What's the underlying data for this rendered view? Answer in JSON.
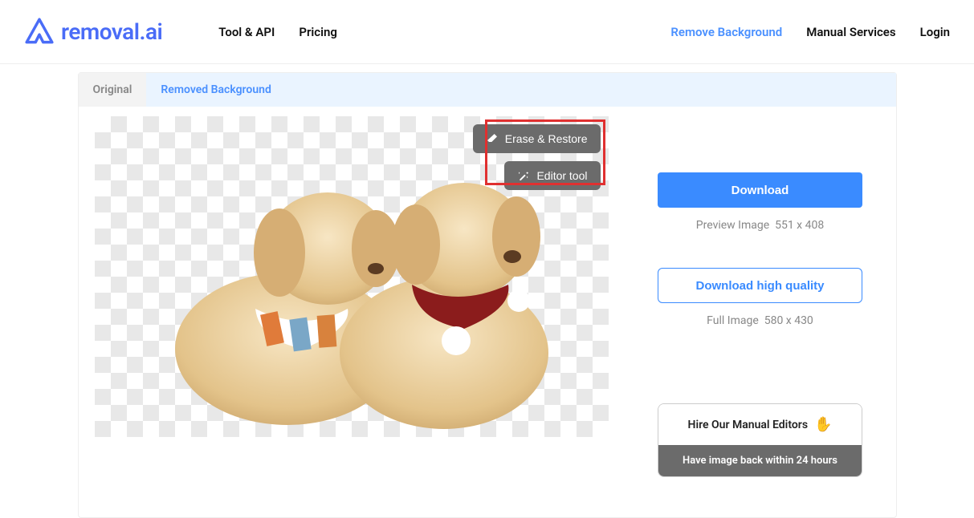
{
  "header": {
    "brand": "removal.ai",
    "nav_left": {
      "tool_api": "Tool & API",
      "pricing": "Pricing"
    },
    "nav_right": {
      "remove_bg": "Remove Background",
      "manual": "Manual Services",
      "login": "Login"
    }
  },
  "tabs": {
    "original": "Original",
    "removed": "Removed Background"
  },
  "overlay": {
    "erase_restore": "Erase & Restore",
    "editor_tool": "Editor tool"
  },
  "sidebar": {
    "download": "Download",
    "preview_label": "Preview Image",
    "preview_dims": "551 x 408",
    "download_hq": "Download high quality",
    "full_label": "Full Image",
    "full_dims": "580 x 430",
    "hire_title": "Hire Our Manual Editors",
    "hire_sub": "Have image back within 24 hours"
  }
}
